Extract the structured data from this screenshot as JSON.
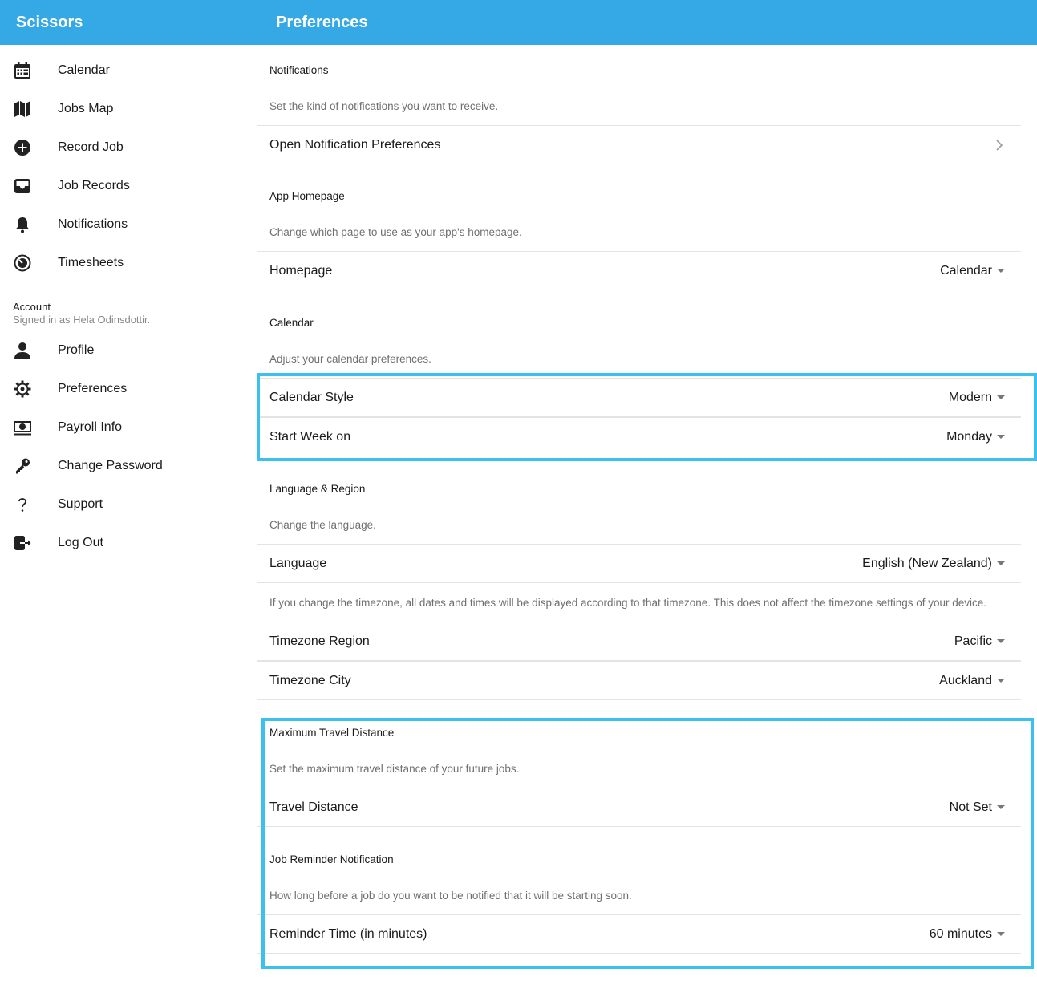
{
  "app": {
    "name": "Scissors",
    "page_title": "Preferences"
  },
  "colors": {
    "header": "#35a8e6",
    "highlight": "#3cc0ee"
  },
  "sidebar": {
    "nav": [
      {
        "label": "Calendar",
        "icon": "calendar-icon"
      },
      {
        "label": "Jobs Map",
        "icon": "map-icon"
      },
      {
        "label": "Record Job",
        "icon": "add-circle-icon"
      },
      {
        "label": "Job Records",
        "icon": "inbox-icon"
      },
      {
        "label": "Notifications",
        "icon": "bell-icon"
      },
      {
        "label": "Timesheets",
        "icon": "timer-icon"
      }
    ],
    "account": {
      "title": "Account",
      "subtitle": "Signed in as Hela Odinsdottir.",
      "items": [
        {
          "label": "Profile",
          "icon": "person-icon"
        },
        {
          "label": "Preferences",
          "icon": "gear-icon"
        },
        {
          "label": "Payroll Info",
          "icon": "money-icon"
        },
        {
          "label": "Change Password",
          "icon": "key-icon"
        },
        {
          "label": "Support",
          "icon": "question-icon"
        },
        {
          "label": "Log Out",
          "icon": "logout-icon"
        }
      ]
    }
  },
  "main": {
    "notifications": {
      "header": "Notifications",
      "note": "Set the kind of notifications you want to receive.",
      "link_label": "Open Notification Preferences"
    },
    "homepage": {
      "header": "App Homepage",
      "note": "Change which page to use as your app's homepage.",
      "label": "Homepage",
      "value": "Calendar"
    },
    "calendar": {
      "header": "Calendar",
      "note": "Adjust your calendar preferences.",
      "style_label": "Calendar Style",
      "style_value": "Modern",
      "week_label": "Start Week on",
      "week_value": "Monday"
    },
    "language": {
      "header": "Language & Region",
      "note": "Change the language.",
      "label": "Language",
      "value": "English (New Zealand)",
      "timezone_note": "If you change the timezone, all dates and times will be displayed according to that timezone. This does not affect the timezone settings of your device.",
      "region_label": "Timezone Region",
      "region_value": "Pacific",
      "city_label": "Timezone City",
      "city_value": "Auckland"
    },
    "travel": {
      "header": "Maximum Travel Distance",
      "note": "Set the maximum travel distance of your future jobs.",
      "label": "Travel Distance",
      "value": "Not Set"
    },
    "reminder": {
      "header": "Job Reminder Notification",
      "note": "How long before a job do you want to be notified that it will be starting soon.",
      "label": "Reminder Time (in minutes)",
      "value": "60 minutes"
    }
  }
}
